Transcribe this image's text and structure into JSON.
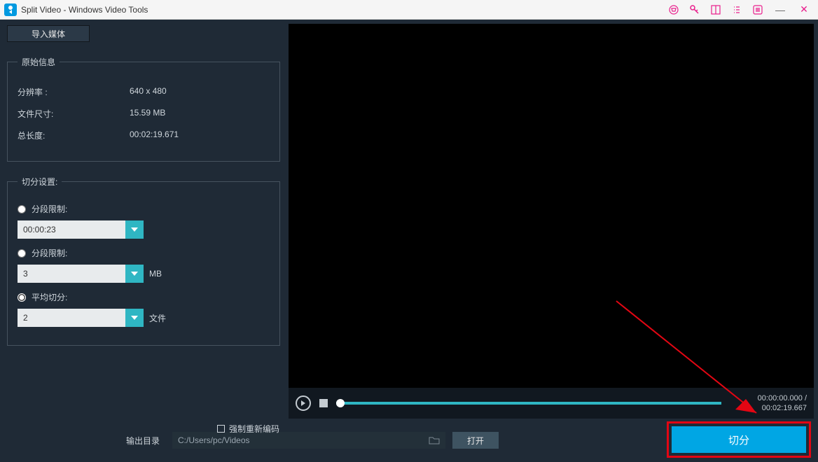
{
  "title": "Split Video - Windows Video Tools",
  "import_btn": "导入媒体",
  "info": {
    "legend": "原始信息",
    "res_label": "分辨率 :",
    "res_val": "640 x 480",
    "size_label": "文件尺寸:",
    "size_val": "15.59 MB",
    "dur_label": "总长度:",
    "dur_val": "00:02:19.671"
  },
  "split": {
    "legend": "切分设置:",
    "time_label": "分段限制:",
    "time_val": "00:00:23",
    "size_label": "分段限制:",
    "size_val": "3",
    "size_unit": "MB",
    "avg_label": "平均切分:",
    "avg_val": "2",
    "avg_unit": "文件"
  },
  "player": {
    "cur": "00:00:00.000 /",
    "total": "00:02:19.667"
  },
  "bottom": {
    "force_label": "强制重新编码",
    "out_label": "输出目录",
    "out_path": "C:/Users/pc/Videos",
    "open_btn": "打开",
    "split_btn": "切分"
  }
}
